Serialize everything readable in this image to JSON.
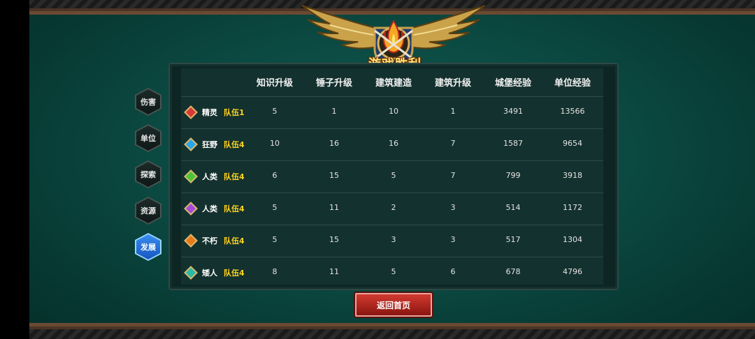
{
  "banner": {
    "title": "游戏胜利"
  },
  "tabs": [
    {
      "label": "伤害",
      "active": false
    },
    {
      "label": "单位",
      "active": false
    },
    {
      "label": "探索",
      "active": false
    },
    {
      "label": "资源",
      "active": false
    },
    {
      "label": "发展",
      "active": true
    }
  ],
  "table": {
    "columns": [
      "知识升级",
      "锤子升级",
      "建筑建造",
      "建筑升级",
      "城堡经验",
      "单位经验"
    ],
    "rows": [
      {
        "race": "精灵",
        "team": "队伍1",
        "color": "#d83838",
        "values": [
          "5",
          "1",
          "10",
          "1",
          "3491",
          "13566"
        ]
      },
      {
        "race": "狂野",
        "team": "队伍4",
        "color": "#2aa6e8",
        "values": [
          "10",
          "16",
          "16",
          "7",
          "1587",
          "9654"
        ]
      },
      {
        "race": "人类",
        "team": "队伍4",
        "color": "#4cc43a",
        "values": [
          "6",
          "15",
          "5",
          "7",
          "799",
          "3918"
        ]
      },
      {
        "race": "人类",
        "team": "队伍4",
        "color": "#a64ad8",
        "values": [
          "5",
          "11",
          "2",
          "3",
          "514",
          "1172"
        ]
      },
      {
        "race": "不朽",
        "team": "队伍4",
        "color": "#e87a1a",
        "values": [
          "5",
          "15",
          "3",
          "3",
          "517",
          "1304"
        ]
      },
      {
        "race": "矮人",
        "team": "队伍4",
        "color": "#2ab8a8",
        "values": [
          "8",
          "11",
          "5",
          "6",
          "678",
          "4796"
        ]
      }
    ]
  },
  "buttons": {
    "return_label": "返回首页"
  }
}
